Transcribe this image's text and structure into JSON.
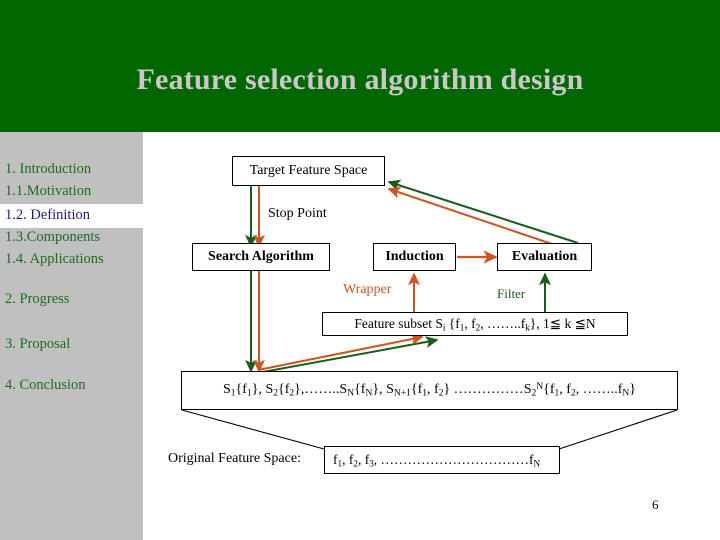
{
  "header": {
    "title": "Feature selection algorithm design",
    "bg_color": "#006600",
    "title_color": "#c8c8c8"
  },
  "sidebar": {
    "bg_color": "#c0c0c0",
    "text_color": "#1f6b1f",
    "active_text_color": "#1a1a8c",
    "active_band_color": "#ffffff",
    "items": [
      {
        "label": "1. Introduction",
        "active": false
      },
      {
        "label": "1.1.Motivation",
        "active": false
      },
      {
        "label": "1.2. Definition",
        "active": true
      },
      {
        "label": "1.3.Components",
        "active": false
      },
      {
        "label": "1.4. Applications",
        "active": false
      },
      {
        "label": "2. Progress",
        "active": false
      },
      {
        "label": "3. Proposal",
        "active": false
      },
      {
        "label": "4. Conclusion",
        "active": false
      }
    ]
  },
  "diagram": {
    "arrow_colors": {
      "green": "#1a5c1a",
      "orange": "#cc5522"
    },
    "boxes": {
      "target_feature_space": "Target Feature Space",
      "search_algorithm": "Search Algorithm",
      "induction": "Induction",
      "evaluation": "Evaluation"
    },
    "labels": {
      "stop_point": "Stop Point",
      "wrapper": "Wrapper",
      "filter": "Filter",
      "original_feature_space": "Original Feature Space:"
    },
    "feature_subset": {
      "prefix": "Feature subset S",
      "sub_i": "i",
      "set_open": " {f",
      "sub_1": "1",
      "mid": ", f",
      "sub_2": "2",
      "dots": ", ……..f",
      "sub_k": "k",
      "set_close": "}, ",
      "range": "1≦ k ≦N"
    },
    "subset_enumeration": {
      "s1": "S",
      "s1_sub": "1",
      "s1_set": "{f",
      "s1_set_sub": "1",
      "s1_close": "}, ",
      "s2": "S",
      "s2_sub": "2",
      "s2_set": "{f",
      "s2_set_sub": "2",
      "s2_close": "},……..",
      "sn": "S",
      "sn_sub": "N",
      "sn_set": "{f",
      "sn_set_sub": "N",
      "sn_close": "}, ",
      "sn1": "S",
      "sn1_sub": "N+1",
      "sn1_set": "{f",
      "sn1_set_sub": "1",
      "sn1_mid": ", f",
      "sn1_mid_sub": "2",
      "sn1_close": "} ……………",
      "last": "S",
      "last_sub": "2",
      "last_sup": "N",
      "last_set": "{f",
      "last_set_sub": "1",
      "last_mid": ", f",
      "last_mid_sub": "2",
      "last_dots": ", ……..f",
      "last_dots_sub": "N",
      "last_close": "}"
    },
    "original_features": {
      "f1": "f",
      "f1_sub": "1",
      "f2": ", f",
      "f2_sub": "2",
      "f3": ", f",
      "f3_sub": "3",
      "dots": ", ……………………………",
      "fn": "f",
      "fn_sub": "N"
    }
  },
  "footer": {
    "page_number": "6"
  }
}
